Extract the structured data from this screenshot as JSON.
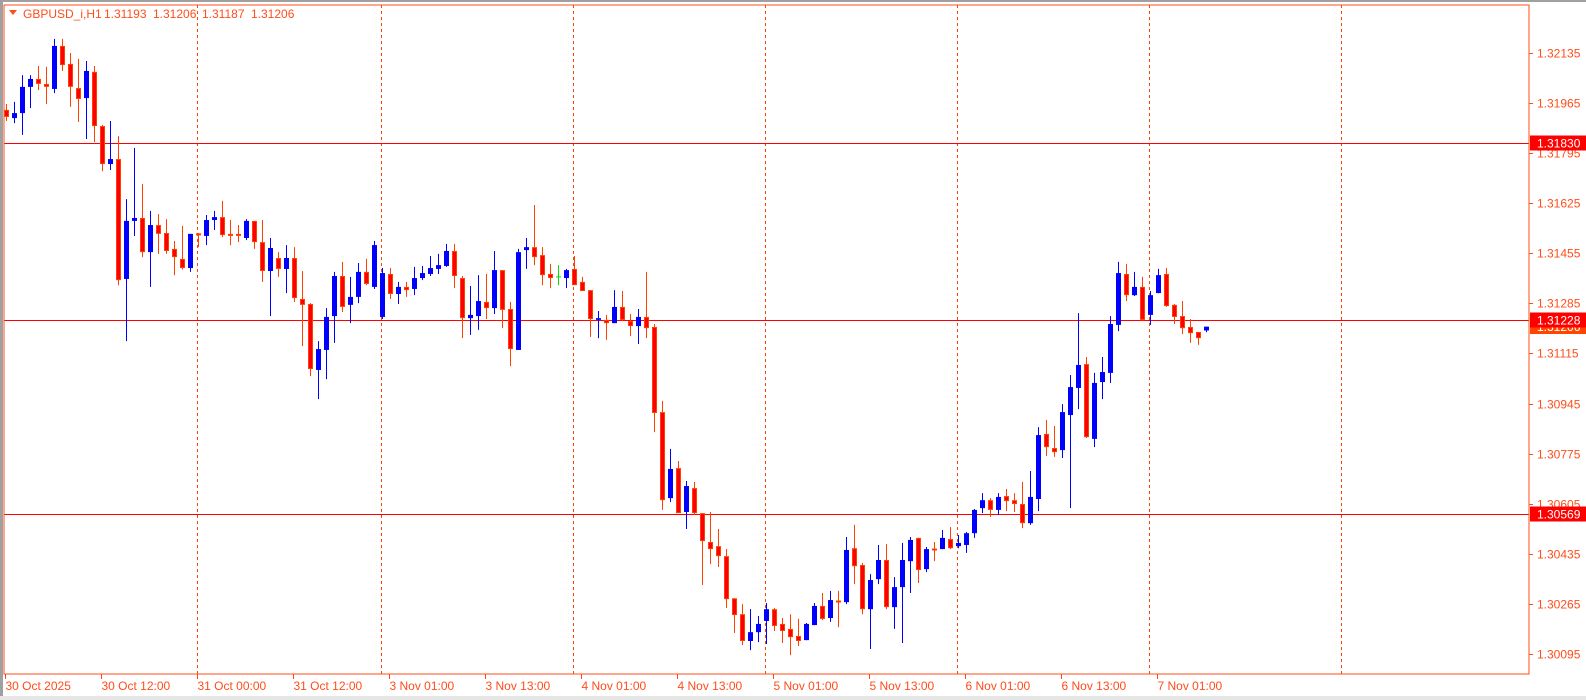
{
  "header": {
    "symbol": "GBPUSD_i,H1",
    "open": "1.31193",
    "high": "1.31206",
    "low": "1.31187",
    "close": "1.31206",
    "menu_icon": "triangle-down-icon"
  },
  "colors": {
    "bull": "#0000ff",
    "bear": "#ff0000",
    "bear_outline": "#ff4000",
    "doji": "#00e000",
    "axis": "#ff4d1a",
    "level_line": "#ff0000",
    "separator": "#ff4500",
    "bid_tag": "#ff4500"
  },
  "chart_data": {
    "type": "candlestick",
    "title": "GBPUSD_i,H1",
    "timeframe": "H1",
    "ylim": [
      1.3004,
      1.323
    ],
    "grid": false,
    "period_separators": true,
    "y_ticks": [
      "1.32135",
      "1.31965",
      "1.31795",
      "1.31625",
      "1.31455",
      "1.31285",
      "1.31115",
      "1.30945",
      "1.30775",
      "1.30605",
      "1.30435",
      "1.30265",
      "1.30095"
    ],
    "x_ticks": [
      "30 Oct 2025",
      "30 Oct 12:00",
      "31 Oct 00:00",
      "31 Oct 12:00",
      "3 Nov 01:00",
      "3 Nov 13:00",
      "4 Nov 01:00",
      "4 Nov 13:00",
      "5 Nov 01:00",
      "5 Nov 13:00",
      "6 Nov 01:00",
      "6 Nov 13:00",
      "7 Nov 01:00"
    ],
    "levels": [
      {
        "price": 1.3183,
        "label": "1.31830"
      },
      {
        "price": 1.31228,
        "label": "1.31228"
      },
      {
        "price": 1.30569,
        "label": "1.30569"
      }
    ],
    "bid": {
      "price": 1.31206,
      "label": "1.31206"
    },
    "ohlc_fields": [
      "open",
      "high",
      "low",
      "close"
    ],
    "ohlc": [
      [
        1.31942,
        1.31962,
        1.31904,
        1.31918
      ],
      [
        1.31914,
        1.31969,
        1.31897,
        1.31931
      ],
      [
        1.31931,
        1.3206,
        1.31857,
        1.3202
      ],
      [
        1.3202,
        1.3206,
        1.31948,
        1.32047
      ],
      [
        1.32047,
        1.32091,
        1.32009,
        1.3203
      ],
      [
        1.3203,
        1.32088,
        1.31962,
        1.3202
      ],
      [
        1.32013,
        1.32183,
        1.31999,
        1.32159
      ],
      [
        1.32159,
        1.32183,
        1.32074,
        1.32094
      ],
      [
        1.32098,
        1.32135,
        1.31952,
        1.3202
      ],
      [
        1.32016,
        1.32115,
        1.31901,
        1.31979
      ],
      [
        1.31982,
        1.32108,
        1.31843,
        1.32074
      ],
      [
        1.32071,
        1.32091,
        1.31833,
        1.31887
      ],
      [
        1.31887,
        1.31891,
        1.31734,
        1.31758
      ],
      [
        1.31758,
        1.31904,
        1.31738,
        1.31775
      ],
      [
        1.31775,
        1.31853,
        1.31347,
        1.31364
      ],
      [
        1.31368,
        1.31639,
        1.31157,
        1.31565
      ],
      [
        1.31565,
        1.31813,
        1.31514,
        1.31575
      ],
      [
        1.31575,
        1.3169,
        1.31442,
        1.31459
      ],
      [
        1.31459,
        1.31599,
        1.31341,
        1.31551
      ],
      [
        1.31551,
        1.31588,
        1.31453,
        1.31521
      ],
      [
        1.31524,
        1.31571,
        1.31453,
        1.31463
      ],
      [
        1.3147,
        1.31497,
        1.31381,
        1.31442
      ],
      [
        1.31436,
        1.31548,
        1.314,
        1.31405
      ],
      [
        1.31405,
        1.31521,
        1.31392,
        1.31521
      ],
      [
        1.31521,
        1.31524,
        1.31476,
        1.31518
      ],
      [
        1.31514,
        1.31585,
        1.31483,
        1.31568
      ],
      [
        1.31568,
        1.31599,
        1.31534,
        1.31578
      ],
      [
        1.31578,
        1.31633,
        1.3151,
        1.31517
      ],
      [
        1.31521,
        1.31568,
        1.31483,
        1.31514
      ],
      [
        1.31521,
        1.31551,
        1.31493,
        1.31514
      ],
      [
        1.31507,
        1.31571,
        1.315,
        1.31565
      ],
      [
        1.31565,
        1.31565,
        1.3147,
        1.31493
      ],
      [
        1.31493,
        1.31568,
        1.31358,
        1.31395
      ],
      [
        1.31395,
        1.31507,
        1.31242,
        1.31473
      ],
      [
        1.31439,
        1.31459,
        1.31375,
        1.31402
      ],
      [
        1.31402,
        1.31483,
        1.3132,
        1.31439
      ],
      [
        1.31439,
        1.31476,
        1.3129,
        1.31303
      ],
      [
        1.313,
        1.31395,
        1.3114,
        1.3128
      ],
      [
        1.31283,
        1.31286,
        1.31038,
        1.31062
      ],
      [
        1.31059,
        1.31157,
        1.3096,
        1.3113
      ],
      [
        1.31127,
        1.31269,
        1.31028,
        1.31239
      ],
      [
        1.31242,
        1.31392,
        1.31151,
        1.31378
      ],
      [
        1.31378,
        1.31426,
        1.31256,
        1.31273
      ],
      [
        1.3128,
        1.31375,
        1.31218,
        1.31307
      ],
      [
        1.31307,
        1.31422,
        1.31286,
        1.31392
      ],
      [
        1.31392,
        1.31436,
        1.31347,
        1.31351
      ],
      [
        1.31341,
        1.31497,
        1.31334,
        1.31483
      ],
      [
        1.31239,
        1.31405,
        1.31232,
        1.31388
      ],
      [
        1.31385,
        1.31405,
        1.313,
        1.31317
      ],
      [
        1.31317,
        1.31358,
        1.31283,
        1.31341
      ],
      [
        1.31341,
        1.31358,
        1.31307,
        1.3133
      ],
      [
        1.31334,
        1.31409,
        1.31313,
        1.31371
      ],
      [
        1.31371,
        1.31412,
        1.31364,
        1.31388
      ],
      [
        1.31385,
        1.31446,
        1.31378,
        1.31405
      ],
      [
        1.31402,
        1.31453,
        1.31385,
        1.31415
      ],
      [
        1.31412,
        1.31487,
        1.31409,
        1.31463
      ],
      [
        1.31463,
        1.31487,
        1.31337,
        1.31378
      ],
      [
        1.31371,
        1.31378,
        1.31167,
        1.31235
      ],
      [
        1.31235,
        1.31344,
        1.31178,
        1.31246
      ],
      [
        1.31242,
        1.31381,
        1.31195,
        1.31293
      ],
      [
        1.3129,
        1.31385,
        1.31232,
        1.31269
      ],
      [
        1.31269,
        1.31463,
        1.31249,
        1.31398
      ],
      [
        1.31398,
        1.31398,
        1.31201,
        1.31263
      ],
      [
        1.31266,
        1.3129,
        1.31072,
        1.3113
      ],
      [
        1.31127,
        1.3147,
        1.31127,
        1.31459
      ],
      [
        1.31466,
        1.31507,
        1.31402,
        1.31476
      ],
      [
        1.31476,
        1.31619,
        1.31415,
        1.31442
      ],
      [
        1.31449,
        1.31476,
        1.31347,
        1.31381
      ],
      [
        1.31385,
        1.31419,
        1.31337,
        1.31371
      ],
      [
        1.31375,
        1.31415,
        1.31347,
        1.31375
      ],
      [
        1.31371,
        1.31402,
        1.31337,
        1.31398
      ],
      [
        1.31402,
        1.31446,
        1.31347,
        1.31347
      ],
      [
        1.31358,
        1.31375,
        1.31327,
        1.31327
      ],
      [
        1.3133,
        1.3133,
        1.31171,
        1.31232
      ],
      [
        1.31229,
        1.31259,
        1.31167,
        1.31235
      ],
      [
        1.31229,
        1.31246,
        1.31161,
        1.31218
      ],
      [
        1.31218,
        1.3133,
        1.31218,
        1.31273
      ],
      [
        1.31273,
        1.31327,
        1.31225,
        1.31229
      ],
      [
        1.31225,
        1.31249,
        1.31174,
        1.31208
      ],
      [
        1.31208,
        1.31266,
        1.31147,
        1.31239
      ],
      [
        1.31239,
        1.31392,
        1.31167,
        1.31201
      ],
      [
        1.31205,
        1.31215,
        1.30848,
        1.30913
      ],
      [
        1.30916,
        1.30954,
        1.30584,
        1.30617
      ],
      [
        1.30624,
        1.30791,
        1.30611,
        1.30723
      ],
      [
        1.30726,
        1.3075,
        1.30573,
        1.30573
      ],
      [
        1.30577,
        1.30682,
        1.30519,
        1.30665
      ],
      [
        1.30658,
        1.30679,
        1.30567,
        1.30573
      ],
      [
        1.30573,
        1.30573,
        1.30329,
        1.30478
      ],
      [
        1.30475,
        1.30577,
        1.304,
        1.30451
      ],
      [
        1.30461,
        1.30519,
        1.3039,
        1.30427
      ],
      [
        1.30427,
        1.30451,
        1.30251,
        1.30281
      ],
      [
        1.30284,
        1.30284,
        1.30166,
        1.30227
      ],
      [
        1.3023,
        1.30264,
        1.30125,
        1.30139
      ],
      [
        1.30139,
        1.30247,
        1.30108,
        1.30169
      ],
      [
        1.30169,
        1.30224,
        1.30135,
        1.30197
      ],
      [
        1.30207,
        1.30268,
        1.30129,
        1.30247
      ],
      [
        1.30247,
        1.30251,
        1.30173,
        1.3019
      ],
      [
        1.30197,
        1.30217,
        1.30132,
        1.30173
      ],
      [
        1.3018,
        1.3023,
        1.30091,
        1.30152
      ],
      [
        1.30156,
        1.30214,
        1.30122,
        1.30139
      ],
      [
        1.30142,
        1.302,
        1.30142,
        1.30197
      ],
      [
        1.30193,
        1.30268,
        1.30193,
        1.30258
      ],
      [
        1.30258,
        1.30302,
        1.3021,
        1.30214
      ],
      [
        1.30217,
        1.30309,
        1.30204,
        1.30278
      ],
      [
        1.30275,
        1.30309,
        1.30186,
        1.30271
      ],
      [
        1.30271,
        1.30492,
        1.30264,
        1.30448
      ],
      [
        1.30454,
        1.30533,
        1.30332,
        1.30393
      ],
      [
        1.30397,
        1.30404,
        1.3023,
        1.30247
      ],
      [
        1.30247,
        1.30366,
        1.30112,
        1.30346
      ],
      [
        1.30349,
        1.30465,
        1.30332,
        1.30414
      ],
      [
        1.30414,
        1.30468,
        1.30247,
        1.30254
      ],
      [
        1.30254,
        1.30356,
        1.3018,
        1.30322
      ],
      [
        1.30322,
        1.30472,
        1.30132,
        1.30414
      ],
      [
        1.3041,
        1.30492,
        1.30302,
        1.30482
      ],
      [
        1.30489,
        1.30489,
        1.30336,
        1.3038
      ],
      [
        1.30383,
        1.30458,
        1.30373,
        1.30451
      ],
      [
        1.30451,
        1.30475,
        1.3041,
        1.30448
      ],
      [
        1.30451,
        1.30516,
        1.30451,
        1.30489
      ],
      [
        1.30485,
        1.30526,
        1.30451,
        1.30454
      ],
      [
        1.30461,
        1.30499,
        1.30454,
        1.30472
      ],
      [
        1.30465,
        1.30509,
        1.30438,
        1.30505
      ],
      [
        1.30505,
        1.30587,
        1.30489,
        1.30584
      ],
      [
        1.3059,
        1.30641,
        1.30573,
        1.30617
      ],
      [
        1.30617,
        1.30624,
        1.3056,
        1.30584
      ],
      [
        1.30584,
        1.30641,
        1.30567,
        1.30628
      ],
      [
        1.30631,
        1.30655,
        1.3058,
        1.30614
      ],
      [
        1.30617,
        1.30641,
        1.30577,
        1.30604
      ],
      [
        1.30604,
        1.30679,
        1.30522,
        1.30539
      ],
      [
        1.30539,
        1.30716,
        1.30533,
        1.30628
      ],
      [
        1.30621,
        1.30865,
        1.3058,
        1.30838
      ],
      [
        1.30842,
        1.30889,
        1.30767,
        1.30797
      ],
      [
        1.30794,
        1.30869,
        1.30764,
        1.3078
      ],
      [
        1.30787,
        1.30943,
        1.3076,
        1.30916
      ],
      [
        1.30906,
        1.31042,
        1.3059,
        1.31001
      ],
      [
        1.30998,
        1.31252,
        1.30926,
        1.31076
      ],
      [
        1.31079,
        1.31103,
        1.30828,
        1.30831
      ],
      [
        1.30825,
        1.31049,
        1.30797,
        1.31015
      ],
      [
        1.31018,
        1.31103,
        1.3096,
        1.31052
      ],
      [
        1.31049,
        1.31242,
        1.31015,
        1.31215
      ],
      [
        1.31212,
        1.31426,
        1.31191,
        1.31388
      ],
      [
        1.31385,
        1.31419,
        1.31293,
        1.31313
      ],
      [
        1.31313,
        1.31392,
        1.3131,
        1.31341
      ],
      [
        1.31341,
        1.31375,
        1.31225,
        1.31229
      ],
      [
        1.31246,
        1.31327,
        1.31212,
        1.31313
      ],
      [
        1.3132,
        1.31402,
        1.3132,
        1.31381
      ],
      [
        1.31385,
        1.31405,
        1.31273,
        1.31276
      ],
      [
        1.3128,
        1.31283,
        1.31215,
        1.31239
      ],
      [
        1.31242,
        1.31293,
        1.31181,
        1.31201
      ],
      [
        1.31205,
        1.31232,
        1.31151,
        1.31184
      ],
      [
        1.31188,
        1.31188,
        1.31144,
        1.31167
      ],
      [
        1.31193,
        1.31206,
        1.31187,
        1.31206
      ]
    ]
  }
}
